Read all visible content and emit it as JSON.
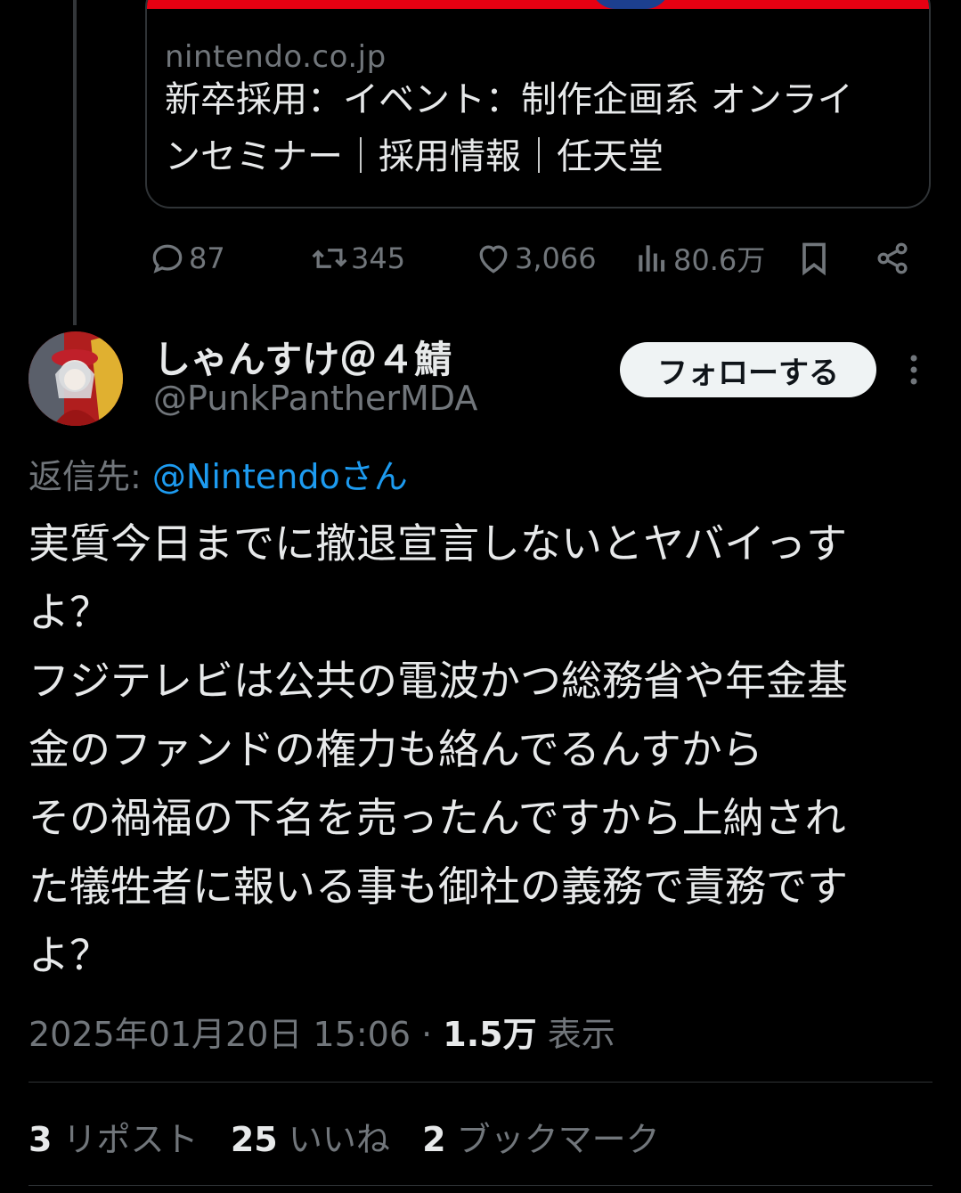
{
  "link_card": {
    "domain": "nintendo.co.jp",
    "title_line1": "新卒採用：イベント：制作企画系 オンライ",
    "title_line2": "ンセミナー｜採用情報｜任天堂"
  },
  "parent_actions": {
    "replies": "87",
    "reposts": "345",
    "likes": "3,066",
    "views": "80.6万"
  },
  "reply": {
    "display_name": "しゃんすけ＠４鯖",
    "handle": "@PunkPantherMDA",
    "follow_label": "フォローする",
    "reply_to_prefix": "返信先:",
    "reply_to_mention": "@Nintendoさん",
    "body_lines": [
      "実質今日までに撤退宣言しないとヤバイっす",
      "よ？",
      "フジテレビは公共の電波かつ総務省や年金基",
      "金のファンドの権力も絡んでるんすから",
      "その禍福の下名を売ったんですから上納され",
      "た犠牲者に報いる事も御社の義務で責務です",
      "よ？"
    ],
    "timestamp": "2025年01月20日 15:06",
    "separator": "·",
    "views_count": "1.5万",
    "views_label": "表示",
    "stats": {
      "reposts_count": "3",
      "reposts_label": "リポスト",
      "likes_count": "25",
      "likes_label": "いいね",
      "bookmarks_count": "2",
      "bookmarks_label": "ブックマーク"
    }
  },
  "colors": {
    "background": "#000000",
    "text": "#e7e9ea",
    "muted": "#71767b",
    "link": "#1d9bf0",
    "border": "#2f3336"
  }
}
